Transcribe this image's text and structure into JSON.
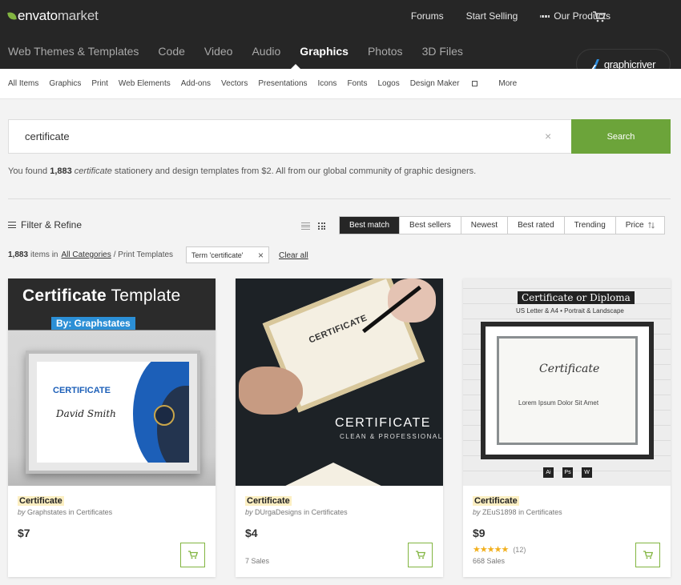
{
  "brand": {
    "name": "envato",
    "suffix": "market",
    "accent": "#82b541"
  },
  "top_links": {
    "forums": "Forums",
    "start_selling": "Start Selling",
    "our_products": "Our Products"
  },
  "categories": [
    "Web Themes & Templates",
    "Code",
    "Video",
    "Audio",
    "Graphics",
    "Photos",
    "3D Files"
  ],
  "active_category": "Graphics",
  "marketplace_badge": "graphicriver",
  "subnav": [
    "All Items",
    "Graphics",
    "Print",
    "Web Elements",
    "Add-ons",
    "Vectors",
    "Presentations",
    "Icons",
    "Fonts",
    "Logos",
    "Design Maker",
    "More"
  ],
  "search": {
    "value": "certificate",
    "button": "Search",
    "clear_glyph": "×"
  },
  "results": {
    "prefix": "You found ",
    "count": "1,883",
    "term": "certificate",
    "suffix": " stationery and design templates from $2. All from our global community of graphic designers."
  },
  "filter": {
    "label": "Filter & Refine"
  },
  "sort_options": [
    "Best match",
    "Best sellers",
    "Newest",
    "Best rated",
    "Trending",
    "Price"
  ],
  "active_sort": "Best match",
  "items_row": {
    "count": "1,883",
    "items_in": "items in",
    "all_categories": "All Categories",
    "path": "/ Print Templates",
    "term_chip": "Term 'certificate'",
    "clear_all": "Clear all"
  },
  "cards": [
    {
      "title": "Certificate",
      "by": "by",
      "author": "Graphstates",
      "in": "in",
      "category": "Certificates",
      "price": "$7",
      "sales": "",
      "stars": "",
      "rating_count": "",
      "thumb": {
        "heading_bold": "Certificate",
        "heading_rest": " Template",
        "sub": "By: Graphstates",
        "cert_title": "CERTIFICATE",
        "cert_name": "David Smith"
      }
    },
    {
      "title": "Certificate",
      "by": "by",
      "author": "DUrgaDesigns",
      "in": "in",
      "category": "Certificates",
      "price": "$4",
      "sales": "7 Sales",
      "stars": "",
      "rating_count": "",
      "thumb": {
        "paper_title": "CERTIFICATE",
        "big": "CERTIFICATE",
        "small": "CLEAN & PROFESSIONAL"
      }
    },
    {
      "title": "Certificate",
      "by": "by",
      "author": "ZEuS1898",
      "in": "in",
      "category": "Certificates",
      "price": "$9",
      "sales": "668 Sales",
      "stars": "★★★★★",
      "rating_count": "(12)",
      "thumb": {
        "heading": "Certificate or Diploma",
        "sub": "US Letter & A4 • Portrait & Landscape",
        "inner_title": "Certificate",
        "inner_line": "Lorem Ipsum Dolor Sit Amet",
        "formats": [
          "Ai",
          "Ps",
          "W"
        ]
      }
    }
  ]
}
